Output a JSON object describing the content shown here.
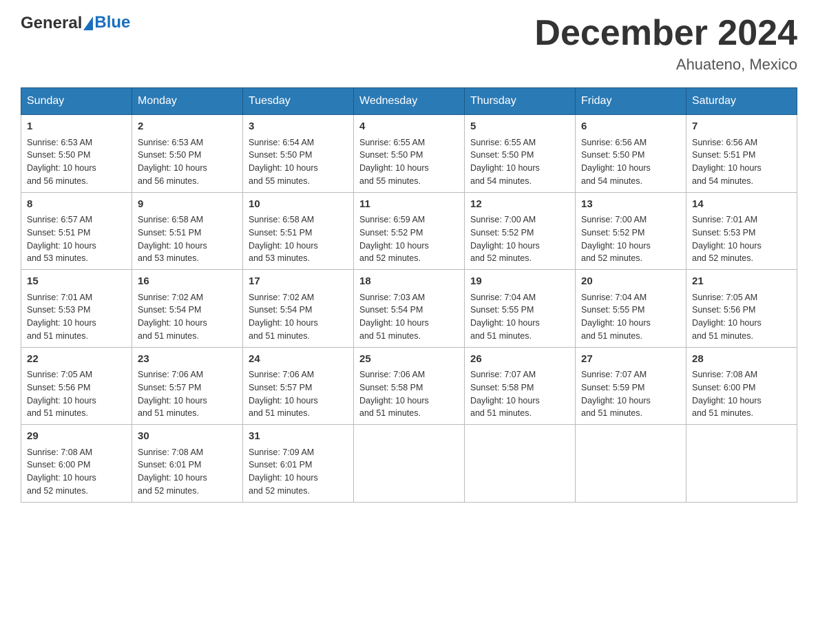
{
  "logo": {
    "general": "General",
    "blue": "Blue"
  },
  "title": {
    "month_year": "December 2024",
    "location": "Ahuateno, Mexico"
  },
  "weekdays": [
    "Sunday",
    "Monday",
    "Tuesday",
    "Wednesday",
    "Thursday",
    "Friday",
    "Saturday"
  ],
  "weeks": [
    [
      {
        "day": "1",
        "sunrise": "6:53 AM",
        "sunset": "5:50 PM",
        "daylight": "10 hours and 56 minutes."
      },
      {
        "day": "2",
        "sunrise": "6:53 AM",
        "sunset": "5:50 PM",
        "daylight": "10 hours and 56 minutes."
      },
      {
        "day": "3",
        "sunrise": "6:54 AM",
        "sunset": "5:50 PM",
        "daylight": "10 hours and 55 minutes."
      },
      {
        "day": "4",
        "sunrise": "6:55 AM",
        "sunset": "5:50 PM",
        "daylight": "10 hours and 55 minutes."
      },
      {
        "day": "5",
        "sunrise": "6:55 AM",
        "sunset": "5:50 PM",
        "daylight": "10 hours and 54 minutes."
      },
      {
        "day": "6",
        "sunrise": "6:56 AM",
        "sunset": "5:50 PM",
        "daylight": "10 hours and 54 minutes."
      },
      {
        "day": "7",
        "sunrise": "6:56 AM",
        "sunset": "5:51 PM",
        "daylight": "10 hours and 54 minutes."
      }
    ],
    [
      {
        "day": "8",
        "sunrise": "6:57 AM",
        "sunset": "5:51 PM",
        "daylight": "10 hours and 53 minutes."
      },
      {
        "day": "9",
        "sunrise": "6:58 AM",
        "sunset": "5:51 PM",
        "daylight": "10 hours and 53 minutes."
      },
      {
        "day": "10",
        "sunrise": "6:58 AM",
        "sunset": "5:51 PM",
        "daylight": "10 hours and 53 minutes."
      },
      {
        "day": "11",
        "sunrise": "6:59 AM",
        "sunset": "5:52 PM",
        "daylight": "10 hours and 52 minutes."
      },
      {
        "day": "12",
        "sunrise": "7:00 AM",
        "sunset": "5:52 PM",
        "daylight": "10 hours and 52 minutes."
      },
      {
        "day": "13",
        "sunrise": "7:00 AM",
        "sunset": "5:52 PM",
        "daylight": "10 hours and 52 minutes."
      },
      {
        "day": "14",
        "sunrise": "7:01 AM",
        "sunset": "5:53 PM",
        "daylight": "10 hours and 52 minutes."
      }
    ],
    [
      {
        "day": "15",
        "sunrise": "7:01 AM",
        "sunset": "5:53 PM",
        "daylight": "10 hours and 51 minutes."
      },
      {
        "day": "16",
        "sunrise": "7:02 AM",
        "sunset": "5:54 PM",
        "daylight": "10 hours and 51 minutes."
      },
      {
        "day": "17",
        "sunrise": "7:02 AM",
        "sunset": "5:54 PM",
        "daylight": "10 hours and 51 minutes."
      },
      {
        "day": "18",
        "sunrise": "7:03 AM",
        "sunset": "5:54 PM",
        "daylight": "10 hours and 51 minutes."
      },
      {
        "day": "19",
        "sunrise": "7:04 AM",
        "sunset": "5:55 PM",
        "daylight": "10 hours and 51 minutes."
      },
      {
        "day": "20",
        "sunrise": "7:04 AM",
        "sunset": "5:55 PM",
        "daylight": "10 hours and 51 minutes."
      },
      {
        "day": "21",
        "sunrise": "7:05 AM",
        "sunset": "5:56 PM",
        "daylight": "10 hours and 51 minutes."
      }
    ],
    [
      {
        "day": "22",
        "sunrise": "7:05 AM",
        "sunset": "5:56 PM",
        "daylight": "10 hours and 51 minutes."
      },
      {
        "day": "23",
        "sunrise": "7:06 AM",
        "sunset": "5:57 PM",
        "daylight": "10 hours and 51 minutes."
      },
      {
        "day": "24",
        "sunrise": "7:06 AM",
        "sunset": "5:57 PM",
        "daylight": "10 hours and 51 minutes."
      },
      {
        "day": "25",
        "sunrise": "7:06 AM",
        "sunset": "5:58 PM",
        "daylight": "10 hours and 51 minutes."
      },
      {
        "day": "26",
        "sunrise": "7:07 AM",
        "sunset": "5:58 PM",
        "daylight": "10 hours and 51 minutes."
      },
      {
        "day": "27",
        "sunrise": "7:07 AM",
        "sunset": "5:59 PM",
        "daylight": "10 hours and 51 minutes."
      },
      {
        "day": "28",
        "sunrise": "7:08 AM",
        "sunset": "6:00 PM",
        "daylight": "10 hours and 51 minutes."
      }
    ],
    [
      {
        "day": "29",
        "sunrise": "7:08 AM",
        "sunset": "6:00 PM",
        "daylight": "10 hours and 52 minutes."
      },
      {
        "day": "30",
        "sunrise": "7:08 AM",
        "sunset": "6:01 PM",
        "daylight": "10 hours and 52 minutes."
      },
      {
        "day": "31",
        "sunrise": "7:09 AM",
        "sunset": "6:01 PM",
        "daylight": "10 hours and 52 minutes."
      },
      null,
      null,
      null,
      null
    ]
  ],
  "labels": {
    "sunrise": "Sunrise:",
    "sunset": "Sunset:",
    "daylight": "Daylight:"
  }
}
